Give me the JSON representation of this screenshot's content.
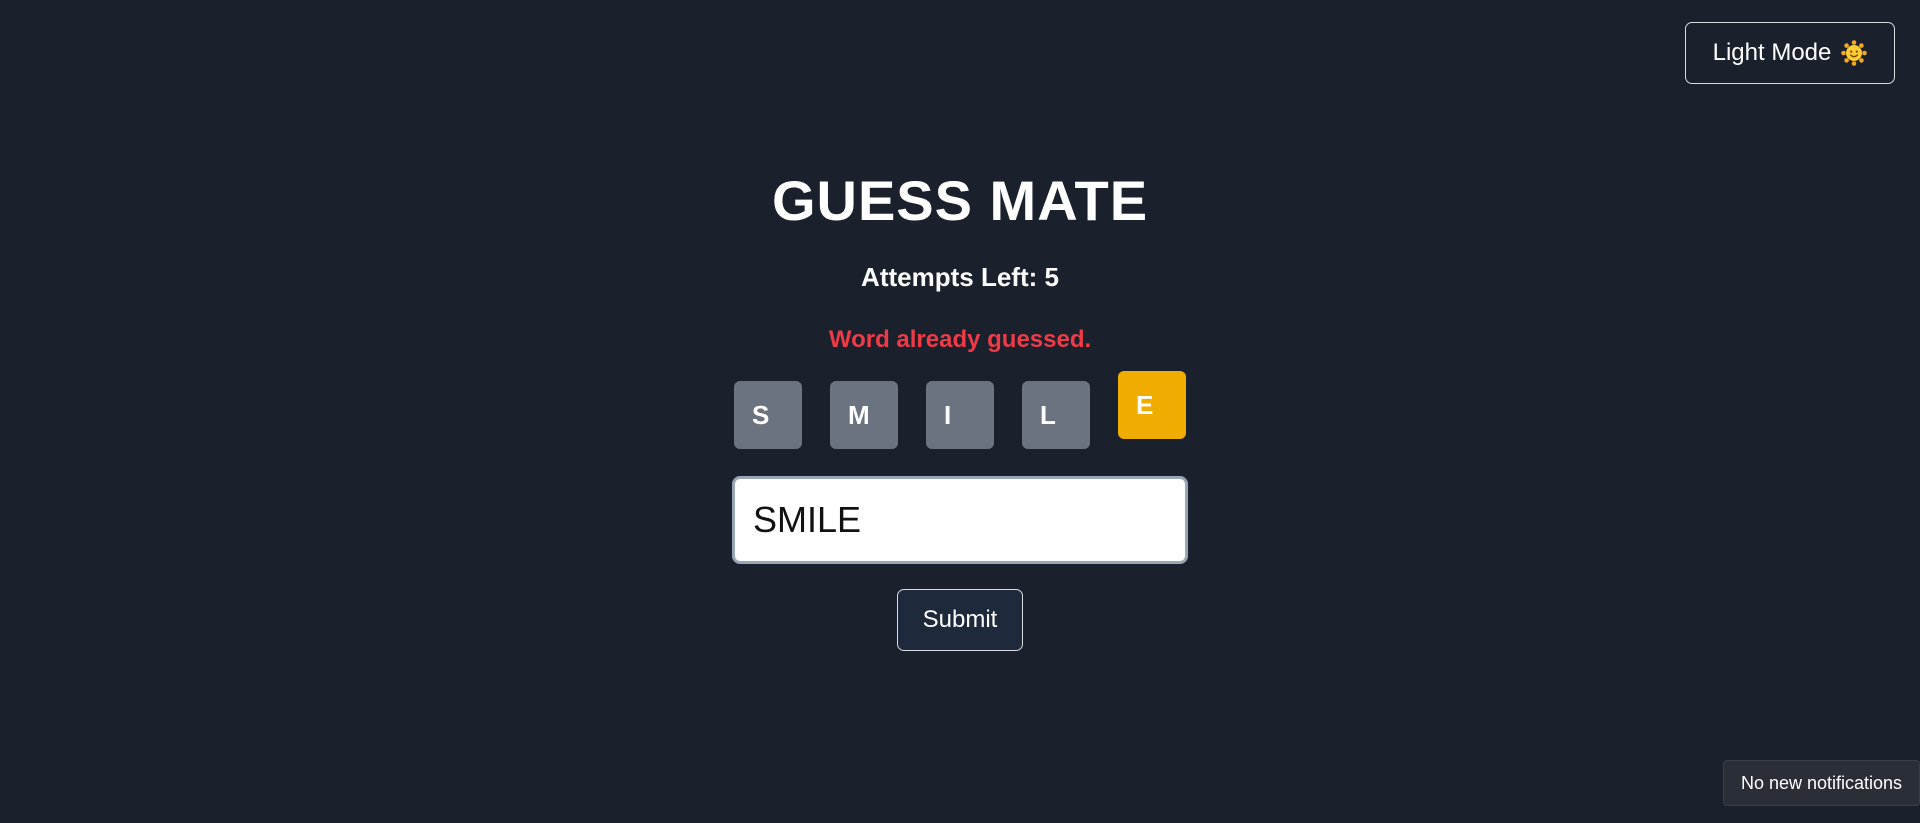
{
  "header": {
    "theme_toggle_label": "Light Mode",
    "theme_toggle_icon": "sun-face-icon"
  },
  "game": {
    "title": "GUESS MATE",
    "attempts_text": "Attempts Left: 5",
    "error_message": "Word already guessed.",
    "tiles": [
      {
        "letter": "S",
        "status": "absent"
      },
      {
        "letter": "M",
        "status": "absent"
      },
      {
        "letter": "I",
        "status": "absent"
      },
      {
        "letter": "L",
        "status": "absent"
      },
      {
        "letter": "E",
        "status": "present"
      }
    ],
    "input_value": "SMILE",
    "submit_label": "Submit"
  },
  "notification": {
    "text": "No new notifications"
  },
  "colors": {
    "background": "#1b202d",
    "error": "#ef3b47",
    "tile_absent": "#6b7280",
    "tile_present": "#f0ad00"
  }
}
